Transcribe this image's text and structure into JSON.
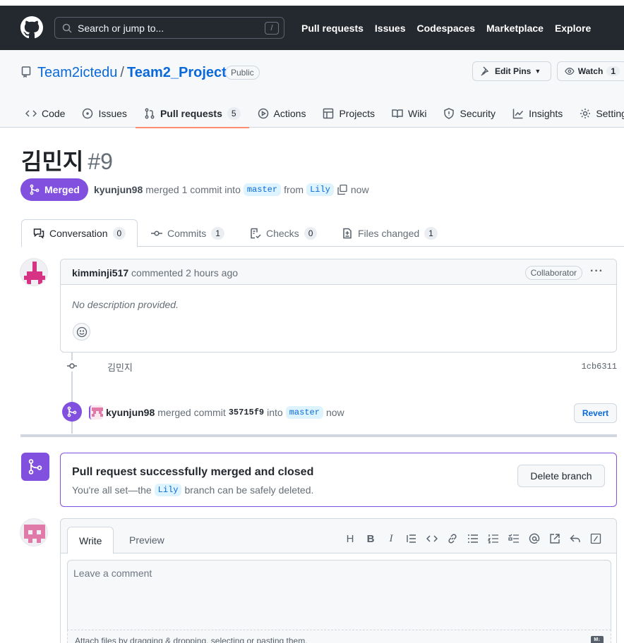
{
  "header": {
    "search_placeholder": "Search or jump to...",
    "search_shortcut": "/",
    "nav": [
      "Pull requests",
      "Issues",
      "Codespaces",
      "Marketplace",
      "Explore"
    ]
  },
  "repo": {
    "owner": "Team2ictedu",
    "separator": "/",
    "name": "Team2_Project",
    "visibility": "Public",
    "edit_pins": "Edit Pins",
    "watch": "Watch",
    "watch_count": "1",
    "tabs": [
      {
        "label": "Code",
        "icon": "code-icon"
      },
      {
        "label": "Issues",
        "icon": "issue-icon"
      },
      {
        "label": "Pull requests",
        "icon": "pull-request-icon",
        "count": "5"
      },
      {
        "label": "Actions",
        "icon": "play-icon"
      },
      {
        "label": "Projects",
        "icon": "table-icon"
      },
      {
        "label": "Wiki",
        "icon": "book-icon"
      },
      {
        "label": "Security",
        "icon": "shield-icon"
      },
      {
        "label": "Insights",
        "icon": "graph-icon"
      },
      {
        "label": "Settings",
        "icon": "gear-icon"
      }
    ]
  },
  "pr": {
    "title": "김민지",
    "number": "#9",
    "state": "Merged",
    "merger": "kyunjun98",
    "meta_merged": "merged 1 commit into",
    "base_branch": "master",
    "meta_from": "from",
    "head_branch": "Lily",
    "meta_time": "now",
    "tabs": [
      {
        "label": "Conversation",
        "count": "0"
      },
      {
        "label": "Commits",
        "count": "1"
      },
      {
        "label": "Checks",
        "count": "0"
      },
      {
        "label": "Files changed",
        "count": "1"
      }
    ]
  },
  "comment": {
    "author": "kimminji517",
    "action": "commented 2 hours ago",
    "role": "Collaborator",
    "menu": "···",
    "body": "No description provided."
  },
  "commit": {
    "message": "김민지",
    "sha": "1cb6311"
  },
  "merge_event": {
    "user": "kyunjun98",
    "text": "merged commit",
    "sha": "35715f9",
    "into": "into",
    "branch": "master",
    "time": "now",
    "revert": "Revert"
  },
  "merge_status": {
    "title": "Pull request successfully merged and closed",
    "desc_before": "You're all set—the",
    "branch": "Lily",
    "desc_after": "branch can be safely deleted.",
    "delete_button": "Delete branch"
  },
  "new_comment": {
    "write_tab": "Write",
    "preview_tab": "Preview",
    "placeholder": "Leave a comment",
    "attach_text": "Attach files by dragging & dropping, selecting or pasting them.",
    "toolbar": [
      "heading-icon",
      "bold-icon",
      "italic-icon",
      "quote-icon",
      "code-icon",
      "link-icon",
      "unordered-list-icon",
      "ordered-list-icon",
      "task-list-icon",
      "mention-icon",
      "reference-icon",
      "reply-icon",
      "slash-icon"
    ]
  },
  "colors": {
    "merged": "#8250df",
    "header_bg": "#24292f",
    "link": "#0969da",
    "tab_underline": "#fd8c73"
  }
}
